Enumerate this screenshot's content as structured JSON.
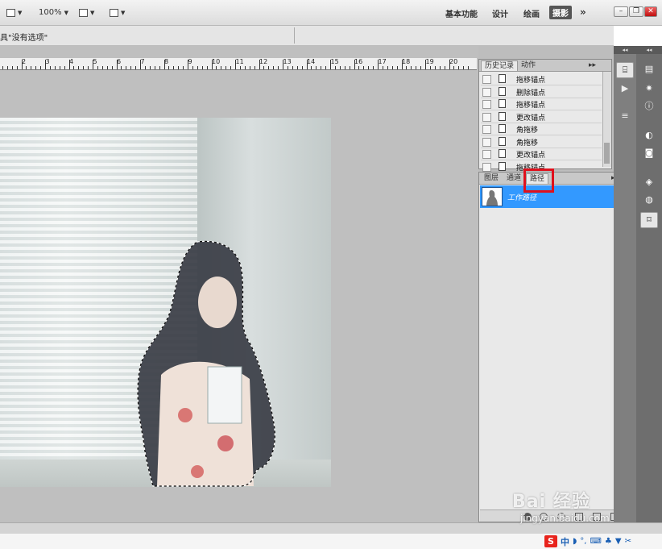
{
  "toolbar": {
    "zoom": "100%",
    "workspaces": [
      "基本功能",
      "设计",
      "绘画",
      "摄影"
    ],
    "active_workspace": "摄影",
    "more": "»"
  },
  "options_bar": {
    "text": "具\"没有选项\""
  },
  "ruler": {
    "labels": [
      "2",
      "3",
      "4",
      "5",
      "6",
      "7",
      "8",
      "9",
      "10",
      "11",
      "12",
      "13",
      "14",
      "15",
      "16",
      "17",
      "18",
      "19",
      "20"
    ]
  },
  "history_panel": {
    "tabs": [
      "历史记录",
      "动作"
    ],
    "active_tab": "历史记录",
    "items": [
      "拖移锚点",
      "删除锚点",
      "拖移锚点",
      "更改锚点",
      "角拖移",
      "角拖移",
      "更改锚点",
      "拖移锚点"
    ]
  },
  "paths_panel": {
    "tabs": [
      "图层",
      "通道",
      "路径"
    ],
    "active_tab": "路径",
    "items": [
      {
        "name": "工作路径"
      }
    ]
  },
  "ime": {
    "logo": "S",
    "lang": "中"
  },
  "watermark": {
    "brand": "Bai 经验",
    "url": "jingyan.baidu.com"
  },
  "colors": {
    "selected": "#3399ff",
    "highlight_box": "#e0101c"
  }
}
